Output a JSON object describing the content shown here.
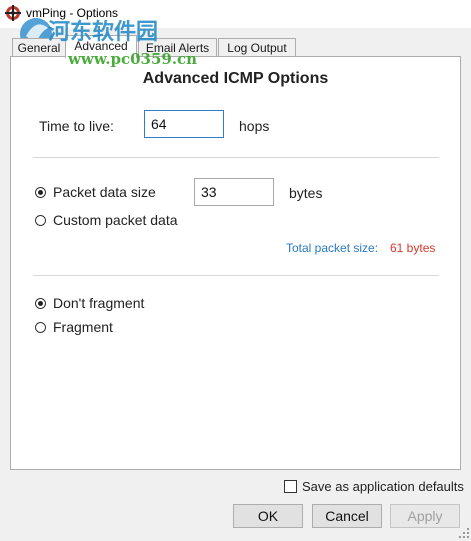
{
  "window": {
    "title": "vmPing - Options"
  },
  "watermark": {
    "text_cn": "河东软件园",
    "url": "www.pc0359.cn"
  },
  "tabs": [
    {
      "label": "General",
      "active": false
    },
    {
      "label": "Advanced",
      "active": true
    },
    {
      "label": "Email Alerts",
      "active": false
    },
    {
      "label": "Log Output",
      "active": false
    }
  ],
  "panel": {
    "title": "Advanced ICMP Options",
    "ttl": {
      "label": "Time to live:",
      "value": "64",
      "unit": "hops"
    },
    "packet": {
      "data_size_label": "Packet data size",
      "data_size_value": "33",
      "data_size_unit": "bytes",
      "data_size_checked": true,
      "custom_label": "Custom packet data",
      "custom_checked": false,
      "total_label": "Total packet size:",
      "total_value": "61 bytes"
    },
    "fragment": {
      "dont_label": "Don't fragment",
      "dont_checked": true,
      "frag_label": "Fragment",
      "frag_checked": false
    }
  },
  "footer": {
    "save_defaults_label": "Save as application defaults",
    "save_defaults_checked": false,
    "ok_label": "OK",
    "cancel_label": "Cancel",
    "apply_label": "Apply",
    "apply_enabled": false
  },
  "colors": {
    "accent_blue": "#2b79c2",
    "value_red": "#d9382c",
    "focus_border": "#2f7fd1"
  }
}
